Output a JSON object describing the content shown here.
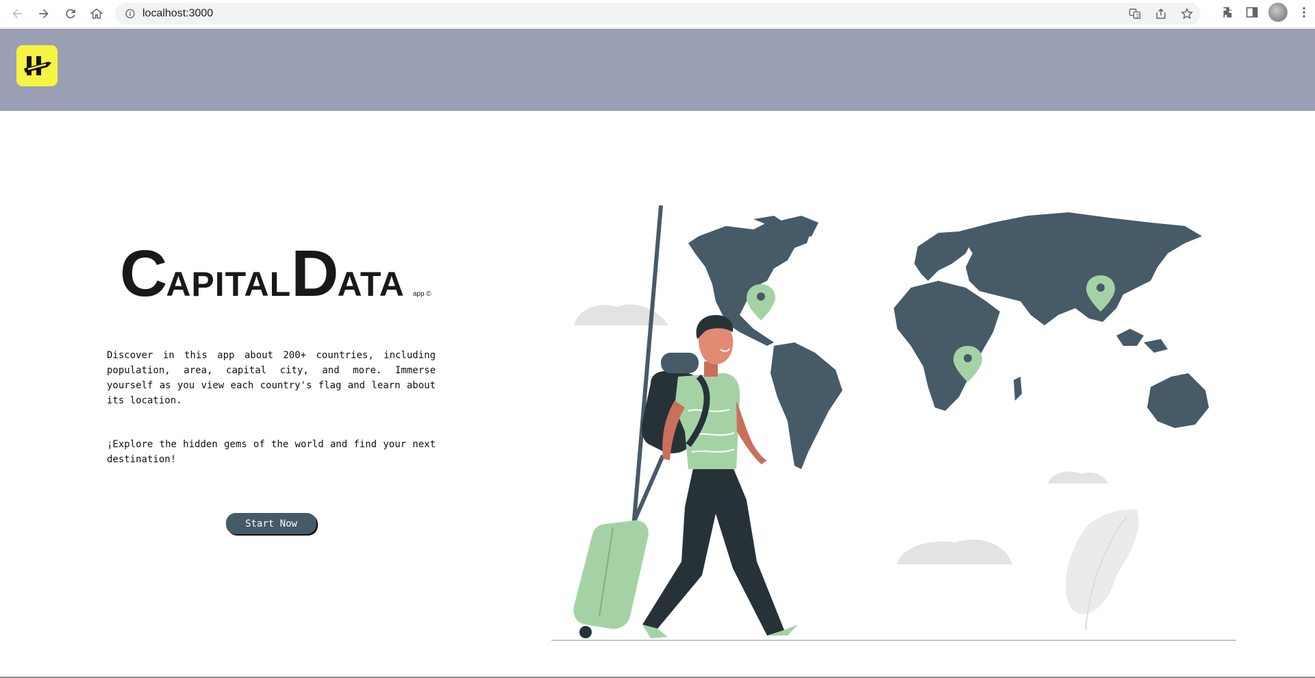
{
  "browser": {
    "url": "localhost:3000"
  },
  "app": {
    "brand": {
      "first_initial": "C",
      "first_rest": "APITAL",
      "second_initial": "D",
      "second_rest": "ATA",
      "suffix": "app ©"
    },
    "description": "Discover in this app about 200+ countries, including population, area, capital city, and more. Immerse yourself as you view each country's flag and learn about its location.",
    "tagline": "¡Explore the hidden gems of the world and find your next destination!",
    "start_label": "Start Now"
  },
  "colors": {
    "header": "#9a9fb4",
    "logo": "#f7f341",
    "button": "#475a68",
    "map": "#475a68",
    "accent_green": "#a5d2a5"
  },
  "icons": [
    "back-icon",
    "forward-icon",
    "reload-icon",
    "home-icon",
    "info-icon",
    "translate-icon",
    "share-icon",
    "star-icon",
    "extensions-icon",
    "side-panel-icon",
    "menu-icon"
  ]
}
